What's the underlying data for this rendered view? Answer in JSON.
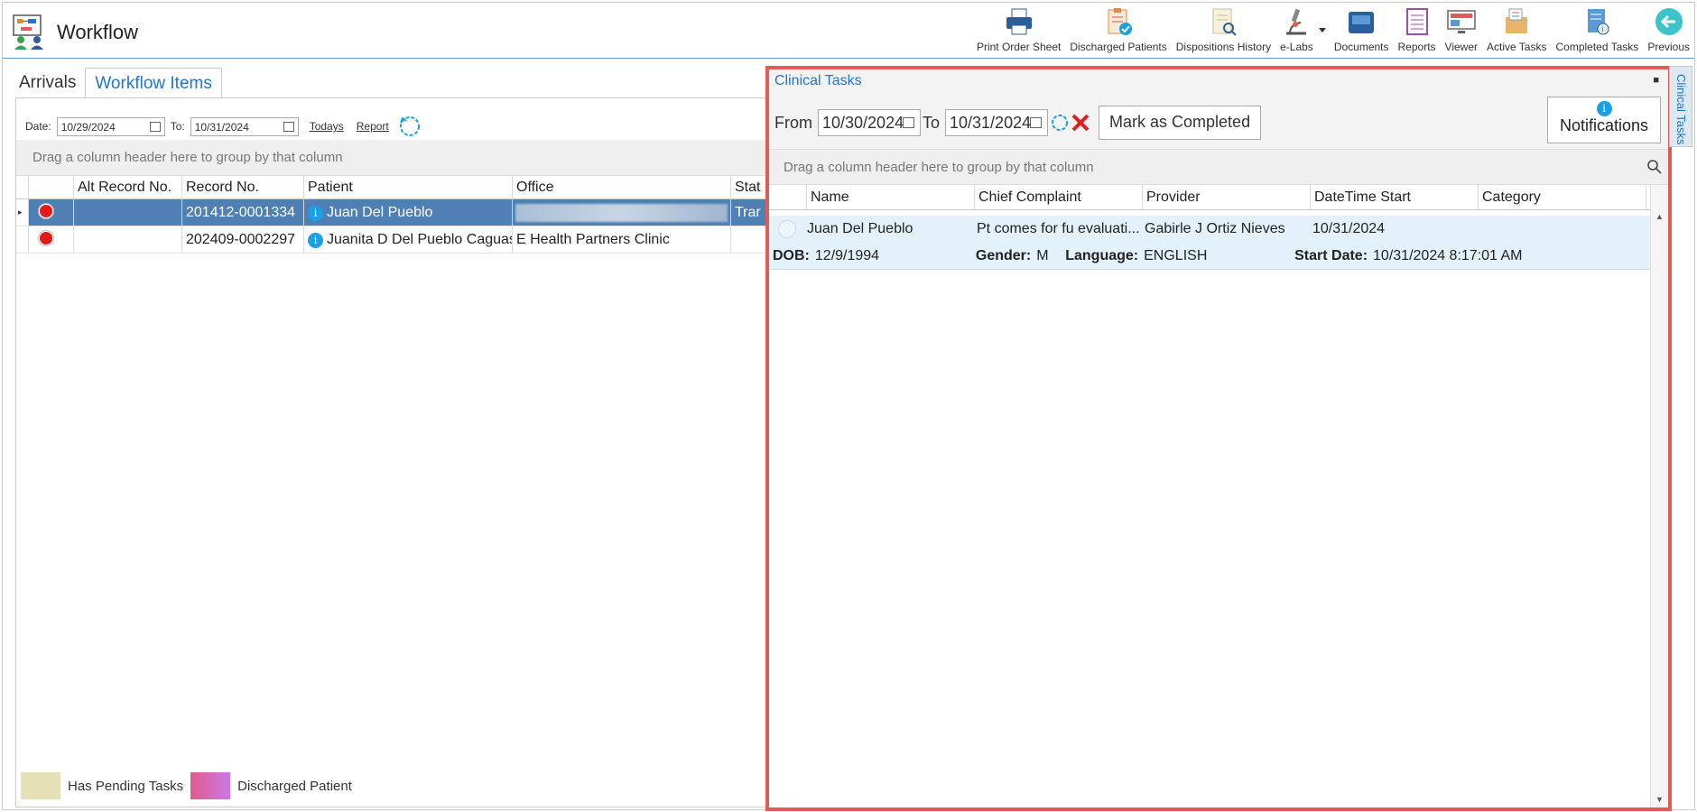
{
  "app": {
    "title": "Workflow"
  },
  "toolbar": {
    "items": [
      {
        "label": "Print Order Sheet",
        "icon": "printer-icon"
      },
      {
        "label": "Discharged Patients",
        "icon": "clipboard-check-icon"
      },
      {
        "label": "Dispositions History",
        "icon": "document-search-icon"
      },
      {
        "label": "e-Labs",
        "icon": "microscope-icon"
      },
      {
        "label": "Documents",
        "icon": "inbox-tray-icon"
      },
      {
        "label": "Reports",
        "icon": "report-list-icon"
      },
      {
        "label": "Viewer",
        "icon": "monitor-icon"
      },
      {
        "label": "Active Tasks",
        "icon": "task-box-icon"
      },
      {
        "label": "Completed Tasks",
        "icon": "completed-doc-icon"
      },
      {
        "label": "Previous",
        "icon": "back-arrow-icon"
      }
    ]
  },
  "tabs": {
    "arrivals": "Arrivals",
    "workflow_items": "Workflow Items"
  },
  "filters": {
    "date_label": "Date:",
    "date_from": "10/29/2024",
    "to_label": "To:",
    "date_to": "10/31/2024",
    "todays_link": "Todays",
    "report_link": "Report"
  },
  "group_hint": "Drag a column header here to group by that column",
  "grid": {
    "columns": [
      "Alt Record No.",
      "Record No.",
      "Patient",
      "Office",
      "Stat"
    ],
    "rows": [
      {
        "alt": "",
        "record": "201412-0001334",
        "patient": "Juan Del Pueblo",
        "office": "",
        "status": "Trar"
      },
      {
        "alt": "",
        "record": "202409-0002297",
        "patient": "Juanita D Del Pueblo Caguas",
        "office": "E Health Partners Clinic",
        "status": ""
      }
    ]
  },
  "legend": {
    "pending": "Has Pending Tasks",
    "discharged": "Discharged Patient"
  },
  "clinical_tasks": {
    "title": "Clinical Tasks",
    "from_label": "From",
    "date_from": "10/30/2024",
    "to_label": "To",
    "date_to": "10/31/2024",
    "mark_completed": "Mark as Completed",
    "notifications": "Notifications",
    "group_hint": "Drag a column header here to group by that column",
    "columns": [
      "Name",
      "Chief Complaint",
      "Provider",
      "DateTime Start",
      "Category"
    ],
    "row": {
      "name": "Juan Del Pueblo",
      "complaint": "Pt comes for fu evaluati...",
      "provider": "Gabirle J Ortiz Nieves",
      "datetime": "10/31/2024",
      "category": "",
      "dob_label": "DOB:",
      "dob": "12/9/1994",
      "gender_label": "Gender:",
      "gender": "M",
      "language_label": "Language:",
      "language": "ENGLISH",
      "start_label": "Start Date:",
      "start": "10/31/2024 8:17:01 AM"
    },
    "side_tab": "Clinical Tasks"
  },
  "colors": {
    "accent": "#1f77c8",
    "selected_row": "#4f7fb5",
    "highlight_border": "#e35b52",
    "status_dot": "#e21a1a"
  }
}
